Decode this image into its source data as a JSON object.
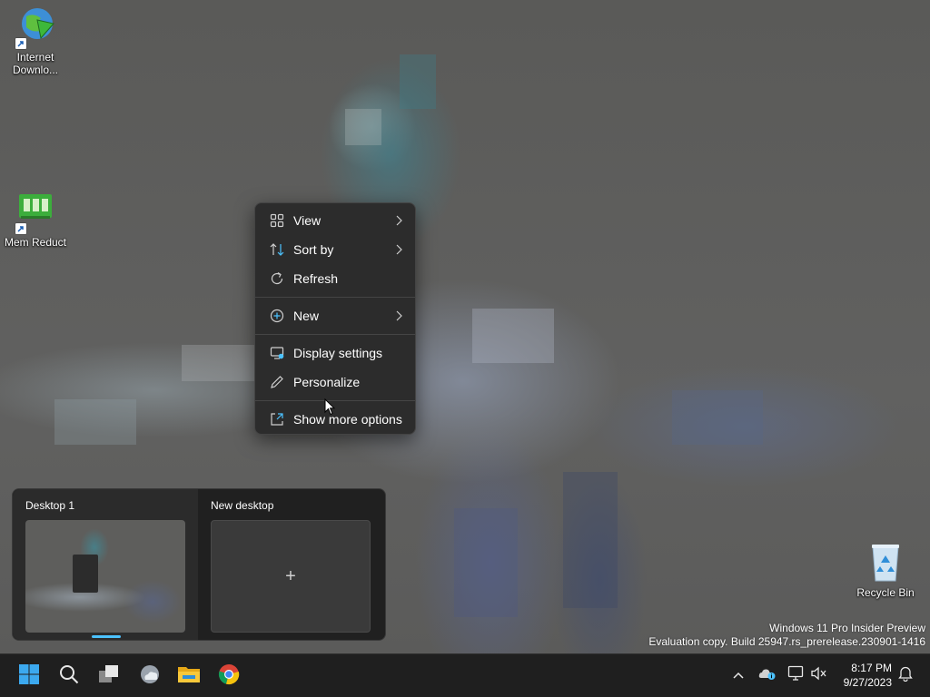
{
  "desktop": {
    "icons": [
      {
        "label": "Internet Downlo...",
        "icon": "internet-download-manager-icon"
      },
      {
        "label": "Mem Reduct",
        "icon": "mem-reduct-icon"
      },
      {
        "label": "Recycle Bin",
        "icon": "recycle-bin-icon"
      }
    ]
  },
  "context_menu": {
    "items": [
      {
        "label": "View",
        "icon": "grid-view-icon",
        "submenu": true
      },
      {
        "label": "Sort by",
        "icon": "sort-icon",
        "submenu": true
      },
      {
        "label": "Refresh",
        "icon": "refresh-icon",
        "submenu": false
      },
      {
        "label": "New",
        "icon": "plus-circle-icon",
        "submenu": true
      },
      {
        "label": "Display settings",
        "icon": "display-settings-icon",
        "submenu": false
      },
      {
        "label": "Personalize",
        "icon": "pen-icon",
        "submenu": false
      },
      {
        "label": "Show more options",
        "icon": "show-more-options-icon",
        "submenu": false
      }
    ]
  },
  "task_view": {
    "desktops": [
      {
        "title": "Desktop 1",
        "active": true
      },
      {
        "title": "New desktop",
        "active": false
      }
    ],
    "add_glyph": "+"
  },
  "watermark": {
    "line1": "Windows 11 Pro Insider Preview",
    "line2": "Evaluation copy. Build 25947.rs_prerelease.230901-1416"
  },
  "taskbar": {
    "apps": [
      "start-icon",
      "search-icon",
      "task-view-icon",
      "weather-icon",
      "file-explorer-icon",
      "chrome-icon"
    ],
    "clock": {
      "time": "8:17 PM",
      "date": "9/27/2023"
    }
  },
  "colors": {
    "accent": "#4cc2ff",
    "menu_bg": "#2c2c2c",
    "taskbar_bg": "#1f1f1f"
  }
}
